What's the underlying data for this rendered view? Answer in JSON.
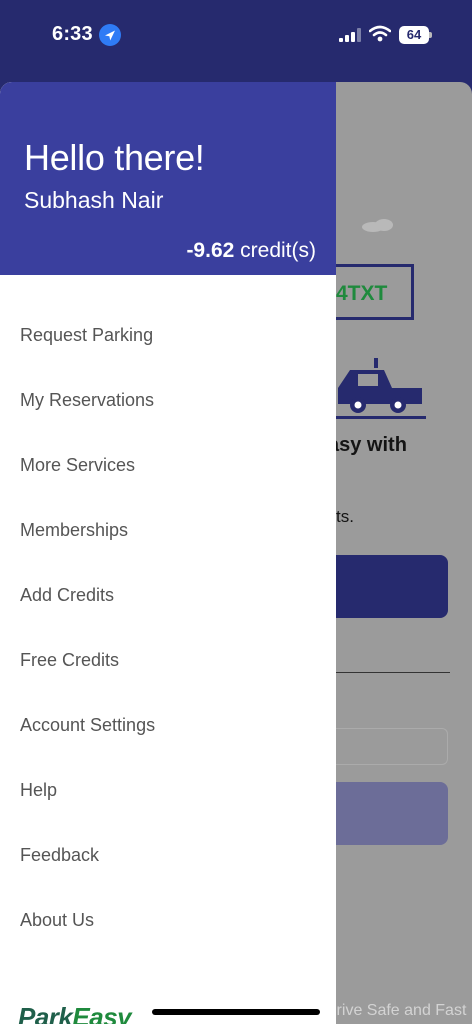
{
  "status_bar": {
    "time": "6:33",
    "battery": "64"
  },
  "drawer": {
    "greeting": "Hello there!",
    "user_name": "Subhash Nair",
    "credits_value": "-9.62",
    "credits_unit": "credit(s)",
    "menu_items": [
      {
        "label": "Request Parking"
      },
      {
        "label": "My Reservations"
      },
      {
        "label": "More Services"
      },
      {
        "label": "Memberships"
      },
      {
        "label": "Add Credits"
      },
      {
        "label": "Free Credits"
      },
      {
        "label": "Account Settings"
      },
      {
        "label": "Help"
      },
      {
        "label": "Feedback"
      },
      {
        "label": "About Us"
      }
    ],
    "brand_prefix": "Park",
    "brand_suffix": "Easy"
  },
  "background_screen": {
    "sign_text": "4TXT",
    "tagline_partial": "asy with",
    "subtext_partial": "ts.",
    "footer_text": "Drive Safe and Fast"
  },
  "colors": {
    "header_bg": "#3a3f9e",
    "status_bar_bg": "#262a6e",
    "primary_button": "#262a6e",
    "accent_green": "#1f8a3d",
    "overlay": "#9b9b9b"
  },
  "icons": [
    "location-arrow-icon",
    "signal-icon",
    "wifi-icon",
    "battery-icon"
  ]
}
